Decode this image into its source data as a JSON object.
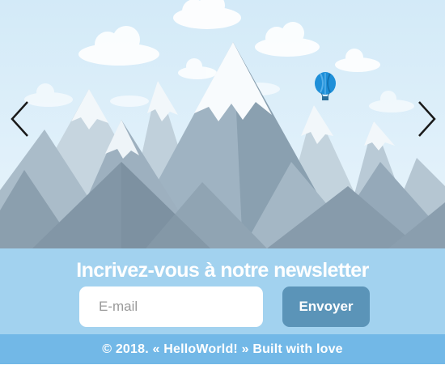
{
  "hero": {
    "illustration": "mountain-landscape-with-hot-air-balloon",
    "prev_icon": "chevron-left-icon",
    "next_icon": "chevron-right-icon"
  },
  "newsletter": {
    "title": "Incrivez-vous à notre newsletter",
    "email_placeholder": "E-mail",
    "email_value": "",
    "submit_label": "Envoyer"
  },
  "footer": {
    "text": "© 2018. « HelloWorld! » Built with love"
  },
  "colors": {
    "newsletter_bg": "#a2d2ef",
    "button_bg": "#5b94b8",
    "footer_bg": "#72b8e7",
    "balloon": "#1e8fd8"
  }
}
